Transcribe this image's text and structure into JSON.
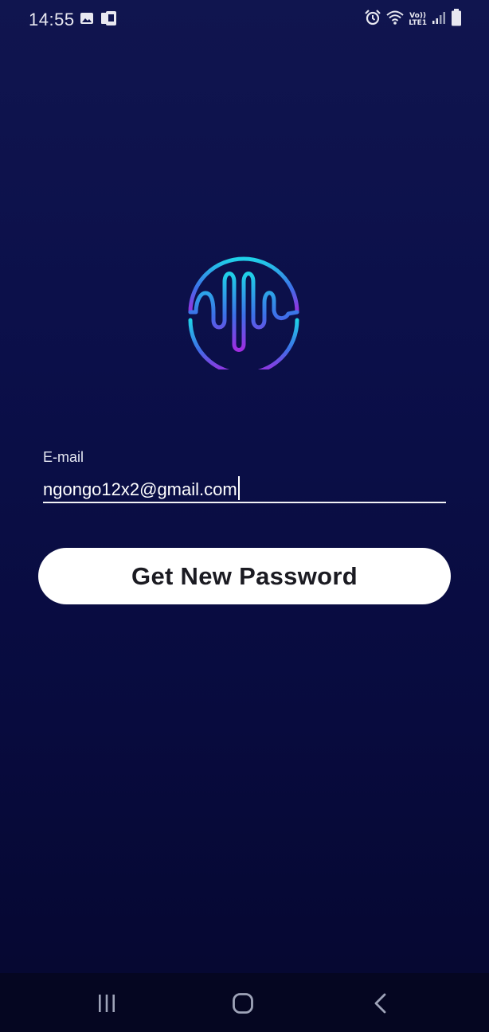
{
  "status_bar": {
    "time": "14:55",
    "left_icons": [
      "image-icon",
      "sim-card-icon"
    ],
    "right_icons": [
      "alarm-icon",
      "wifi-icon",
      "volte-icon",
      "signal-icon",
      "battery-icon"
    ],
    "network_top": "Vo))",
    "network_bottom": "LTE1"
  },
  "logo": {
    "icon": "sound-wave-logo-icon",
    "gradient_colors": [
      "#1fd1e8",
      "#3d6fe8",
      "#a02ce0"
    ]
  },
  "form": {
    "email_label": "E-mail",
    "email_value": "ngongo12x2@gmail.com"
  },
  "actions": {
    "submit_label": "Get New Password"
  },
  "navigation": {
    "buttons": [
      "recent-apps-icon",
      "home-icon",
      "back-icon"
    ]
  },
  "colors": {
    "background_top": "#10154f",
    "background_bottom": "#05072f",
    "button_bg": "#ffffff",
    "button_text": "#1b1b22"
  }
}
